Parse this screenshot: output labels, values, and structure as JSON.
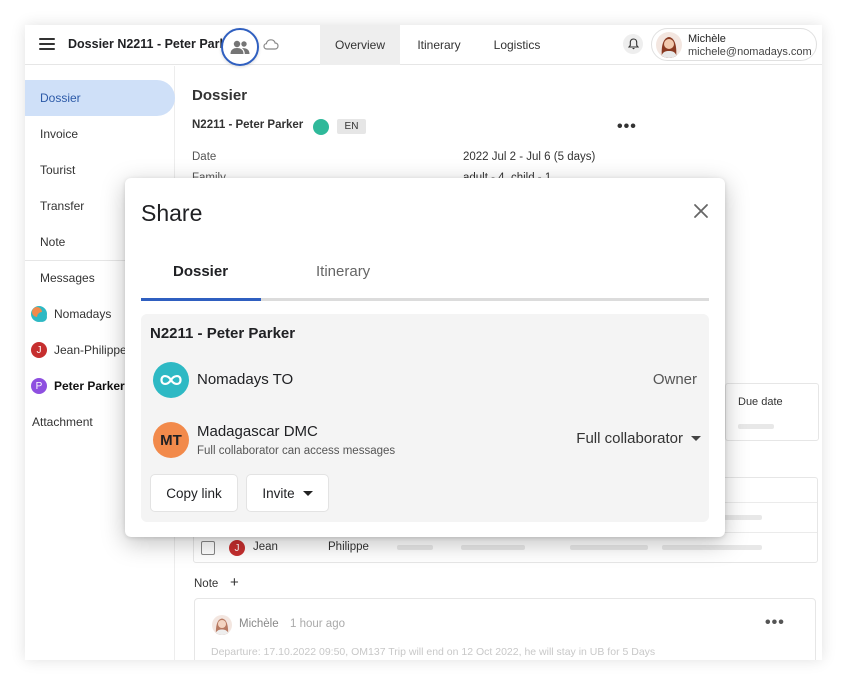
{
  "header": {
    "dossier_title": "Dossier N2211 - Peter Parker",
    "tabs": [
      {
        "label": "Overview"
      },
      {
        "label": "Itinerary"
      },
      {
        "label": "Logistics"
      }
    ],
    "user": {
      "name": "Michèle",
      "email": "michele@nomadays.com"
    }
  },
  "sidebar": {
    "items": [
      {
        "label": "Dossier"
      },
      {
        "label": "Invoice"
      },
      {
        "label": "Tourist"
      },
      {
        "label": "Transfer"
      },
      {
        "label": "Note"
      },
      {
        "label": "Messages"
      }
    ],
    "messages": [
      {
        "label": "Nomadays",
        "initial": ""
      },
      {
        "label": "Jean-Philippe",
        "initial": "J"
      },
      {
        "label": "Peter Parker",
        "initial": "P"
      }
    ],
    "attachment_label": "Attachment"
  },
  "main": {
    "title": "Dossier",
    "code": "N2211 - Peter Parker",
    "lang": "EN",
    "date_label": "Date",
    "date_value": "2022 Jul 2 - Jul 6 (5 days)",
    "family_label": "Family",
    "family_value": "adult - 4, child - 1",
    "due_date_header": "Due date",
    "tourist_row": {
      "initial": "J",
      "first": "Jean",
      "last": "Philippe"
    },
    "note_label": "Note",
    "note_add": "+",
    "note": {
      "author": "Michèle",
      "time": "1 hour ago",
      "text": "Departure: 17.10.2022 09:50, OM137 Trip will end on 12 Oct 2022, he will stay in UB for 5 Days"
    }
  },
  "modal": {
    "title": "Share",
    "tabs": [
      {
        "label": "Dossier"
      },
      {
        "label": "Itinerary"
      }
    ],
    "panel_title": "N2211 - Peter Parker",
    "parties": [
      {
        "name": "Nomadays TO",
        "role": "Owner",
        "avatar_text": ""
      },
      {
        "name": "Madagascar DMC",
        "subtitle": "Full collaborator can access messages",
        "role": "Full collaborator",
        "avatar_text": "MT"
      }
    ],
    "copy_link_label": "Copy link",
    "invite_label": "Invite"
  },
  "colors": {
    "accent_blue": "#2f5fc0",
    "active_side": "#cfe0f8",
    "status_green": "#2fb99a",
    "nomadays_teal": "#2eb9c4",
    "mt_orange": "#f28a4b",
    "jean_red": "#c62f2f",
    "peter_purple": "#8e4fe0"
  }
}
